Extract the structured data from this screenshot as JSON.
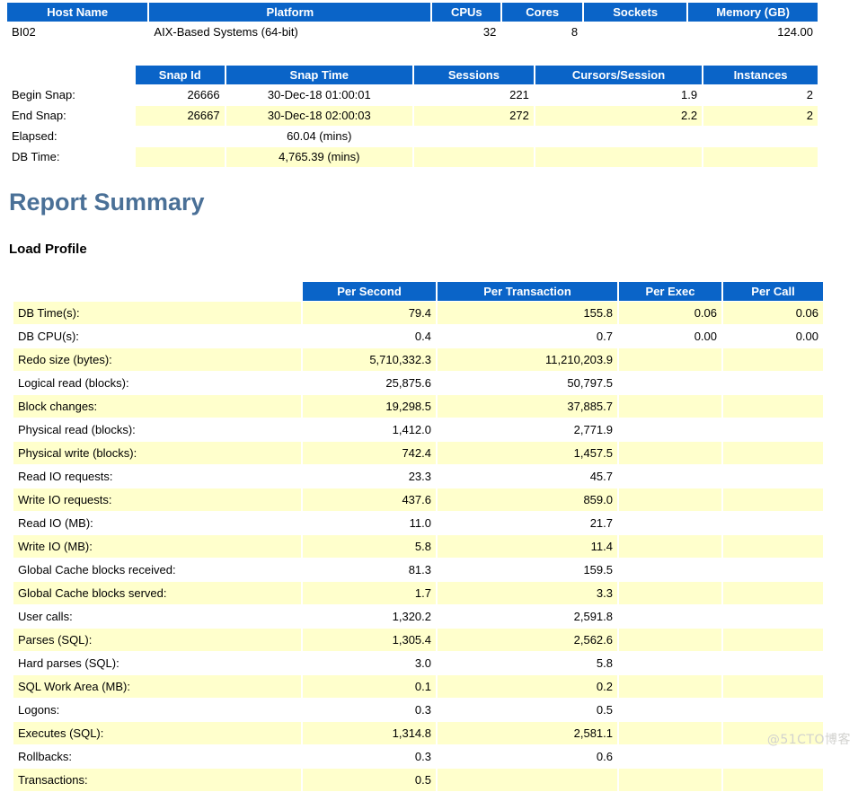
{
  "host_table": {
    "headers": [
      "Host Name",
      "Platform",
      "CPUs",
      "Cores",
      "Sockets",
      "Memory (GB)"
    ],
    "rows": [
      [
        "BI02",
        "AIX-Based Systems (64-bit)",
        "32",
        "8",
        "",
        "124.00"
      ]
    ]
  },
  "snap_table": {
    "headers": [
      "",
      "Snap Id",
      "Snap Time",
      "Sessions",
      "Cursors/Session",
      "Instances"
    ],
    "rows": [
      [
        "Begin Snap:",
        "26666",
        "30-Dec-18 01:00:01",
        "221",
        "1.9",
        "2"
      ],
      [
        "End Snap:",
        "26667",
        "30-Dec-18 02:00:03",
        "272",
        "2.2",
        "2"
      ],
      [
        "Elapsed:",
        "",
        "60.04 (mins)",
        "",
        "",
        ""
      ],
      [
        "DB Time:",
        "",
        "4,765.39 (mins)",
        "",
        "",
        ""
      ]
    ]
  },
  "report_summary": {
    "title": "Report Summary",
    "load_profile": {
      "title": "Load Profile",
      "headers": [
        "",
        "Per Second",
        "Per Transaction",
        "Per Exec",
        "Per Call"
      ],
      "rows": [
        [
          "DB Time(s):",
          "79.4",
          "155.8",
          "0.06",
          "0.06"
        ],
        [
          "DB CPU(s):",
          "0.4",
          "0.7",
          "0.00",
          "0.00"
        ],
        [
          "Redo size (bytes):",
          "5,710,332.3",
          "11,210,203.9",
          "",
          ""
        ],
        [
          "Logical read (blocks):",
          "25,875.6",
          "50,797.5",
          "",
          ""
        ],
        [
          "Block changes:",
          "19,298.5",
          "37,885.7",
          "",
          ""
        ],
        [
          "Physical read (blocks):",
          "1,412.0",
          "2,771.9",
          "",
          ""
        ],
        [
          "Physical write (blocks):",
          "742.4",
          "1,457.5",
          "",
          ""
        ],
        [
          "Read IO requests:",
          "23.3",
          "45.7",
          "",
          ""
        ],
        [
          "Write IO requests:",
          "437.6",
          "859.0",
          "",
          ""
        ],
        [
          "Read IO (MB):",
          "11.0",
          "21.7",
          "",
          ""
        ],
        [
          "Write IO (MB):",
          "5.8",
          "11.4",
          "",
          ""
        ],
        [
          "Global Cache blocks received:",
          "81.3",
          "159.5",
          "",
          ""
        ],
        [
          "Global Cache blocks served:",
          "1.7",
          "3.3",
          "",
          ""
        ],
        [
          "User calls:",
          "1,320.2",
          "2,591.8",
          "",
          ""
        ],
        [
          "Parses (SQL):",
          "1,305.4",
          "2,562.6",
          "",
          ""
        ],
        [
          "Hard parses (SQL):",
          "3.0",
          "5.8",
          "",
          ""
        ],
        [
          "SQL Work Area (MB):",
          "0.1",
          "0.2",
          "",
          ""
        ],
        [
          "Logons:",
          "0.3",
          "0.5",
          "",
          ""
        ],
        [
          "Executes (SQL):",
          "1,314.8",
          "2,581.1",
          "",
          ""
        ],
        [
          "Rollbacks:",
          "0.3",
          "0.6",
          "",
          ""
        ],
        [
          "Transactions:",
          "0.5",
          "",
          "",
          ""
        ]
      ]
    }
  },
  "watermark": "@51CTO博客",
  "colors": {
    "header_blue": "#0a64c8",
    "band_yellow": "#ffffcc",
    "title_blue": "#4a7097",
    "watermark_gray": "#d2d2cf"
  }
}
